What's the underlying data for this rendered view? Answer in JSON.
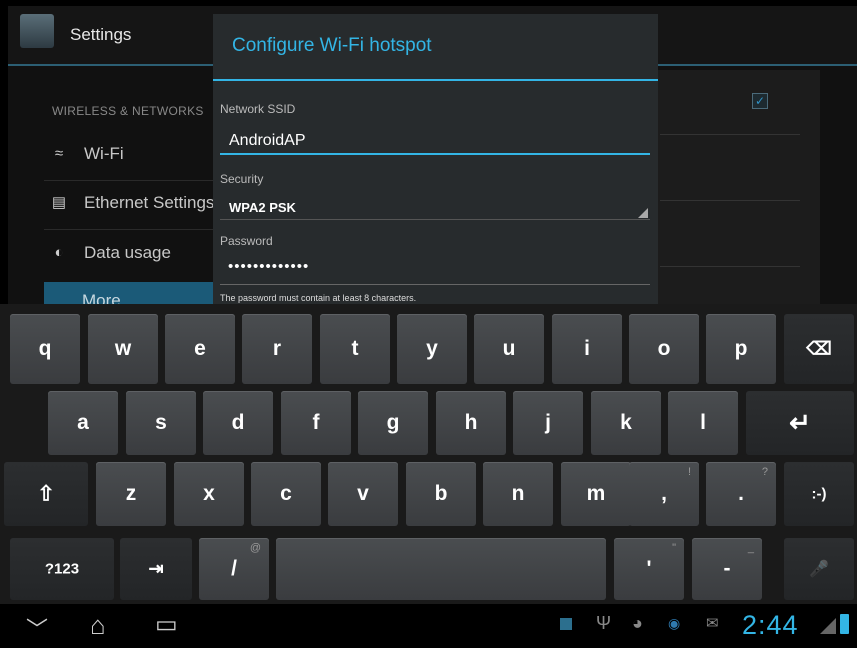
{
  "actionbar": {
    "title": "Settings"
  },
  "settings": {
    "section_header": "WIRELESS & NETWORKS",
    "items": [
      {
        "label": "Wi-Fi",
        "icon": "wifi-icon"
      },
      {
        "label": "Ethernet Settings",
        "icon": "ethernet-icon"
      },
      {
        "label": "Data usage",
        "icon": "data-usage-icon"
      },
      {
        "label": "More",
        "icon": ""
      }
    ],
    "detail_checkbox": "✓"
  },
  "dialog": {
    "title": "Configure Wi-Fi hotspot",
    "ssid_label": "Network SSID",
    "ssid_value": "AndroidAP",
    "security_label": "Security",
    "security_value": "WPA2 PSK",
    "password_label": "Password",
    "password_value": "•••••••••••••",
    "password_hint": "The password must contain at least 8 characters."
  },
  "keyboard": {
    "row1": [
      "q",
      "w",
      "e",
      "r",
      "t",
      "y",
      "u",
      "i",
      "o",
      "p"
    ],
    "backspace": "⌫",
    "row2": [
      "a",
      "s",
      "d",
      "f",
      "g",
      "h",
      "j",
      "k",
      "l"
    ],
    "enter": "↵",
    "shift": "⇧",
    "row3": [
      "z",
      "x",
      "c",
      "v",
      "b",
      "n",
      "m"
    ],
    "comma": ",",
    "comma_hint": "!",
    "period": ".",
    "period_hint": "?",
    "smiley": ":-)",
    "symbols": "?123",
    "tab": "⇥",
    "slash": "/",
    "slash_hint": "@",
    "apostrophe": "'",
    "apostrophe_hint": "\"",
    "dash": "-",
    "dash_hint": "_",
    "mic": "🎤"
  },
  "navbar": {
    "back": "﹀",
    "home": "⌂",
    "recents": "▭",
    "clock": "2:44"
  },
  "colors": {
    "accent": "#33b5e5",
    "selected_row": "#1b5a78"
  }
}
